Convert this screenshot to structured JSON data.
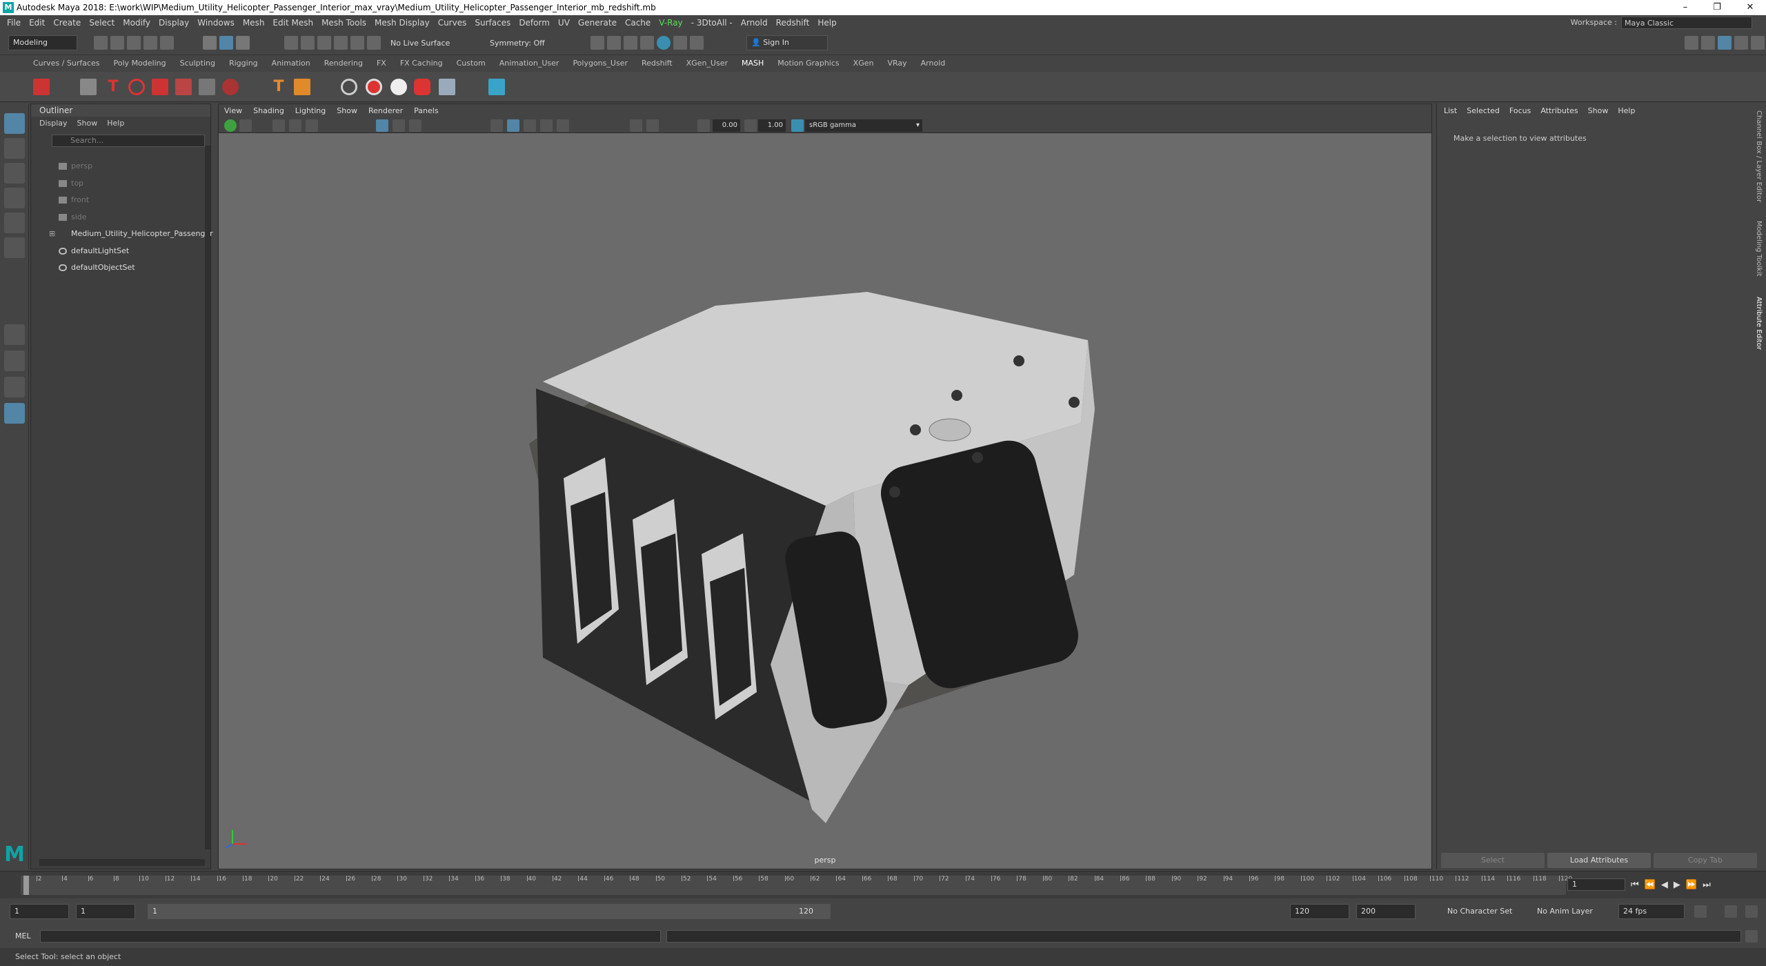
{
  "window": {
    "title": "Autodesk Maya 2018: E:\\work\\WIP\\Medium_Utility_Helicopter_Passenger_Interior_max_vray\\Medium_Utility_Helicopter_Passenger_Interior_mb_redshift.mb",
    "minimize": "–",
    "maximize": "❐",
    "close": "✕"
  },
  "menubar": {
    "items": [
      "File",
      "Edit",
      "Create",
      "Select",
      "Modify",
      "Display",
      "Windows",
      "Mesh",
      "Edit Mesh",
      "Mesh Tools",
      "Mesh Display",
      "Curves",
      "Surfaces",
      "Deform",
      "UV",
      "Generate",
      "Cache",
      "V-Ray",
      "- 3DtoAll -",
      "Arnold",
      "Redshift",
      "Help"
    ],
    "workspace_label": "Workspace :",
    "workspace_value": "Maya Classic"
  },
  "statusline": {
    "mode": "Modeling",
    "live_surface": "No Live Surface",
    "symmetry": "Symmetry: Off",
    "sign_in": "Sign In"
  },
  "shelf": {
    "tabs": [
      "Curves / Surfaces",
      "Poly Modeling",
      "Sculpting",
      "Rigging",
      "Animation",
      "Rendering",
      "FX",
      "FX Caching",
      "Custom",
      "Animation_User",
      "Polygons_User",
      "Redshift",
      "XGen_User",
      "MASH",
      "Motion Graphics",
      "XGen",
      "VRay",
      "Arnold"
    ],
    "active": "MASH"
  },
  "outliner": {
    "title": "Outliner",
    "menu": [
      "Display",
      "Show",
      "Help"
    ],
    "search_placeholder": "Search...",
    "items": [
      {
        "label": "persp",
        "dim": true
      },
      {
        "label": "top",
        "dim": true
      },
      {
        "label": "front",
        "dim": true
      },
      {
        "label": "side",
        "dim": true
      },
      {
        "label": "Medium_Utility_Helicopter_Passenger",
        "dim": false
      },
      {
        "label": "defaultLightSet",
        "dim": false
      },
      {
        "label": "defaultObjectSet",
        "dim": false
      }
    ]
  },
  "viewport": {
    "menu": [
      "View",
      "Shading",
      "Lighting",
      "Show",
      "Renderer",
      "Panels"
    ],
    "exposure": "0.00",
    "gamma": "1.00",
    "color_space": "sRGB gamma",
    "camera": "persp"
  },
  "attribute_editor": {
    "tabs": [
      "List",
      "Selected",
      "Focus",
      "Attributes",
      "Show",
      "Help"
    ],
    "message": "Make a selection to view attributes",
    "buttons": [
      "Select",
      "Load Attributes",
      "Copy Tab"
    ],
    "side_tabs": [
      "Channel Box / Layer Editor",
      "Modeling Toolkit",
      "Attribute Editor"
    ]
  },
  "timeline": {
    "ticks": [
      1,
      2,
      4,
      6,
      8,
      10,
      12,
      14,
      16,
      18,
      20,
      22,
      24,
      26,
      28,
      30,
      32,
      34,
      36,
      38,
      40,
      42,
      44,
      46,
      48,
      50,
      52,
      54,
      56,
      58,
      60,
      62,
      64,
      66,
      68,
      70,
      72,
      74,
      76,
      78,
      80,
      82,
      84,
      86,
      88,
      90,
      92,
      94,
      96,
      98,
      100,
      102,
      104,
      106,
      108,
      110,
      112,
      114,
      116,
      118,
      120
    ],
    "current_frame": "1"
  },
  "range": {
    "start": "1",
    "playback_start": "1",
    "slider_start": "1",
    "slider_end": "120",
    "playback_end": "120",
    "end": "200",
    "character_set": "No Character Set",
    "anim_layer": "No Anim Layer",
    "fps": "24 fps"
  },
  "commandline": {
    "label": "MEL"
  },
  "helpline": {
    "text": "Select Tool: select an object"
  },
  "colors": {
    "accent": "#5285a6",
    "vray_green": "#5ce05c",
    "maya_teal": "#0fa4a6"
  }
}
